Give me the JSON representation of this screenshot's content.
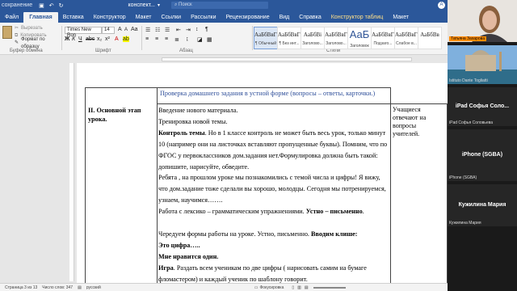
{
  "titlebar": {
    "autosave": "сохранение",
    "doc_title": "конспект...",
    "search_placeholder": "Поиск",
    "user_initial": "А"
  },
  "tabs": [
    {
      "label": "Файл",
      "active": false
    },
    {
      "label": "Главная",
      "active": true
    },
    {
      "label": "Вставка",
      "active": false
    },
    {
      "label": "Конструктор",
      "active": false
    },
    {
      "label": "Макет",
      "active": false
    },
    {
      "label": "Ссылки",
      "active": false
    },
    {
      "label": "Рассылки",
      "active": false
    },
    {
      "label": "Рецензирование",
      "active": false
    },
    {
      "label": "Вид",
      "active": false
    },
    {
      "label": "Справка",
      "active": false
    },
    {
      "label": "Конструктор таблиц",
      "active": false,
      "context": true
    },
    {
      "label": "Макет",
      "active": false
    }
  ],
  "ribbon": {
    "clipboard": {
      "cut": "Вырезать",
      "copy": "Копировать",
      "format_painter": "Формат по образцу",
      "group_label": "Буфер обмена"
    },
    "font": {
      "font_name": "Times New Ron",
      "font_size": "14",
      "group_label": "Шрифт"
    },
    "paragraph": {
      "group_label": "Абзац"
    },
    "styles": {
      "group_label": "Стили",
      "items": [
        {
          "sample": "АаБбВвГг,",
          "name": "¶ Обычный",
          "selected": true
        },
        {
          "sample": "АаБбВвГг,",
          "name": "¶ Без инт...",
          "selected": false
        },
        {
          "sample": "АаБбВі",
          "name": "Заголово...",
          "selected": false
        },
        {
          "sample": "АаБбВвГ",
          "name": "Заголово...",
          "selected": false
        },
        {
          "sample": "АаБ",
          "name": "Заголовок",
          "selected": false,
          "big": true
        },
        {
          "sample": "АаБбВвГ",
          "name": "Подзаго...",
          "selected": false
        },
        {
          "sample": "АаБбВвГг",
          "name": "Слабое в...",
          "selected": false
        },
        {
          "sample": "АаБбВв",
          "name": "",
          "selected": false
        }
      ]
    }
  },
  "document": {
    "row1_text": "Проверка домашнего задания в устной форме (вопросы – ответы, карточки.)",
    "stage_label": "II. Основной этап урока.",
    "student_note": "Учащиеся отвечают на вопросы учителей.",
    "lines": [
      "Введение нового материала.",
      "Тренировка новой темы.",
      "Контроль темы. Но в 1 классе контроль не может быть весь урок, только минут",
      "10 (например они на листочках вставляют пропущенные буквы). Помним, что по",
      "ФГОС у первоклассников дом.задания нет.Формулировка должна быть такой:",
      "допишите, нарисуйте, обведите.",
      "Ребята , на прошлом уроке мы познакомились с темой числа и цифры! Я вижу,",
      "что дом.задание тоже сделали вы хорошо, молодцы. Сегодня мы потренируемся,",
      "узнаем, научимся…….",
      "Работа с лексико – грамматическим упражнениями. Устно – письменно.",
      "",
      "Чередуем формы работы на уроке. Устно, письменно. Вводим клише:",
      "Это цифра…..",
      "Мне нравится один.",
      "Игра. Раздать всем ученикам по две цифры ( нарисовать самим на бумаге",
      "фломастером) и каждый ученик по шаблону говорит."
    ]
  },
  "statusbar": {
    "page": "Страница 3 из 13",
    "words": "Число слов: 347",
    "language": "русский",
    "focus": "Фокусировка"
  },
  "participants": [
    {
      "label": "Татьяна Захарова",
      "center_name": ""
    },
    {
      "label": "Istituto Dante Togliatti",
      "center_name": ""
    },
    {
      "label": "iPad Софья Соловьева",
      "center_name": "iPad Софья Соло..."
    },
    {
      "label": "iPhone (SGBA)",
      "center_name": "iPhone (SGBA)"
    },
    {
      "label": "Кужилина Мария",
      "center_name": "Кужилина Мария"
    }
  ]
}
